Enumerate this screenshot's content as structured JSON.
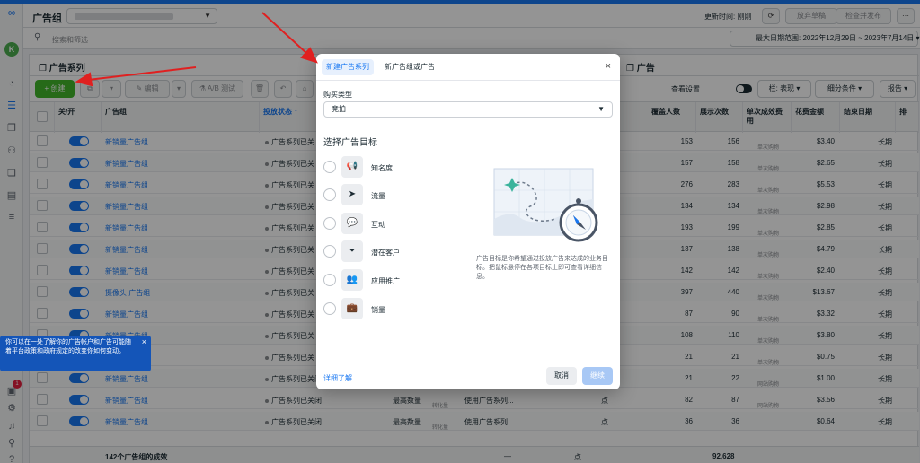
{
  "header": {
    "title": "广告组",
    "update_label": "更新时间: 刚刚",
    "discard_label": "放弃草稿",
    "publish_label": "检查并发布",
    "more_label": "···"
  },
  "search": {
    "placeholder": "搜索和筛选",
    "date_range": "最大日期范围: 2022年12月29日 ~ 2023年7月14日 ▾"
  },
  "panel": {
    "campaign_tab": "广告系列",
    "ads_tab": "广告"
  },
  "toolbar": {
    "create_label": "+ 创建",
    "edit_label": "编辑",
    "ab_test_label": "A/B 测试",
    "view_settings_label": "查看设置",
    "columns_label": "栏: 表现 ▾",
    "breakdown_label": "细分条件 ▾",
    "reports_label": "报告 ▾"
  },
  "table": {
    "columns": [
      "关/开",
      "广告组",
      "投放状态 ↑",
      "覆盖人数",
      "展示次数",
      "单次成效费用",
      "花费金额",
      "结束日期",
      "排"
    ],
    "rows": [
      {
        "name": "新销量广告组",
        "status": "广告系列已关",
        "reach": "153",
        "impressions": "156",
        "cpr_sub": "单次购物",
        "spent": "$3.40",
        "end": "长期"
      },
      {
        "name": "新销量广告组",
        "status": "广告系列已关",
        "reach": "157",
        "impressions": "158",
        "cpr_sub": "单次购物",
        "spent": "$2.65",
        "end": "长期"
      },
      {
        "name": "新销量广告组",
        "status": "广告系列已关",
        "reach": "276",
        "impressions": "283",
        "cpr_sub": "单次购物",
        "spent": "$5.53",
        "end": "长期"
      },
      {
        "name": "新销量广告组",
        "status": "广告系列已关",
        "reach": "134",
        "impressions": "134",
        "cpr_sub": "单次购物",
        "spent": "$2.98",
        "end": "长期"
      },
      {
        "name": "新销量广告组",
        "status": "广告系列已关",
        "reach": "193",
        "impressions": "199",
        "cpr_sub": "单次购物",
        "spent": "$2.85",
        "end": "长期"
      },
      {
        "name": "新销量广告组",
        "status": "广告系列已关",
        "reach": "137",
        "impressions": "138",
        "cpr_sub": "单次购物",
        "spent": "$4.79",
        "end": "长期"
      },
      {
        "name": "新销量广告组",
        "status": "广告系列已关",
        "reach": "142",
        "impressions": "142",
        "cpr_sub": "单次购物",
        "spent": "$2.40",
        "end": "长期"
      },
      {
        "name": "摄像头 广告组",
        "status": "广告系列已关",
        "reach": "397",
        "impressions": "440",
        "cpr_sub": "单次购物",
        "spent": "$13.67",
        "end": "长期"
      },
      {
        "name": "新销量广告组",
        "status": "广告系列已关",
        "reach": "87",
        "impressions": "90",
        "cpr_sub": "单次购物",
        "spent": "$3.32",
        "end": "长期"
      },
      {
        "name": "新销量广告组",
        "status": "广告系列已关",
        "reach": "108",
        "impressions": "110",
        "cpr_sub": "单次购物",
        "spent": "$3.80",
        "end": "长期"
      },
      {
        "name": "新销量广告组",
        "status": "广告系列已关",
        "reach": "21",
        "impressions": "21",
        "cpr_sub": "单次购物",
        "spent": "$0.75",
        "end": "长期"
      },
      {
        "name": "新销量广告组",
        "status": "广告系列已关闭",
        "bid": "最高数量",
        "bid_sub": "转化量",
        "budget": "使用广告系列...",
        "reach": "21",
        "impressions": "22",
        "cpr_sub": "网站购物",
        "spent": "$1.00",
        "end": "长期"
      },
      {
        "name": "新销量广告组",
        "status": "广告系列已关闭",
        "bid": "最高数量",
        "bid_sub": "转化量",
        "budget": "使用广告系列...",
        "reach": "82",
        "impressions": "87",
        "cpr_sub": "网站购物",
        "spent": "$3.56",
        "end": "长期"
      },
      {
        "name": "新销量广告组",
        "status": "广告系列已关闭",
        "bid": "最高数量",
        "bid_sub": "转化量",
        "budget": "使用广告系列...",
        "reach": "36",
        "impressions": "36",
        "cpr_sub": "",
        "spent": "$0.64",
        "end": "长期"
      }
    ],
    "point_label": "点",
    "footer_label": "142个广告组的成效",
    "footer_impressions": "92,628",
    "footer_dash": "—",
    "footer_dots": "点..."
  },
  "tooltip": {
    "text": "你可以在一处了解你的广告帐户和广告可能随着平台政策和政府规定的改变你如何变动。",
    "close": "×"
  },
  "modal": {
    "tab_new_campaign": "新建广告系列",
    "tab_new_adset": "新广告组或广告",
    "close": "×",
    "buying_type_label": "购买类型",
    "buying_type_value": "竞拍",
    "objective_heading": "选择广告目标",
    "objectives": [
      {
        "label": "知名度",
        "icon": "megaphone-icon"
      },
      {
        "label": "流量",
        "icon": "cursor-icon"
      },
      {
        "label": "互动",
        "icon": "chat-bubbles-icon"
      },
      {
        "label": "潜在客户",
        "icon": "funnel-icon"
      },
      {
        "label": "应用推广",
        "icon": "people-icon"
      },
      {
        "label": "销量",
        "icon": "briefcase-icon"
      }
    ],
    "description": "广告目标是你希望通过投放广告来达成的业务目标。把鼠标悬停在各项目标上即可查看详细信息。",
    "learn_more": "详细了解",
    "cancel": "取消",
    "next": "继续"
  },
  "colors": {
    "accent": "#1877f2",
    "create_green": "#42b72a",
    "annotation_red": "#e02020"
  }
}
